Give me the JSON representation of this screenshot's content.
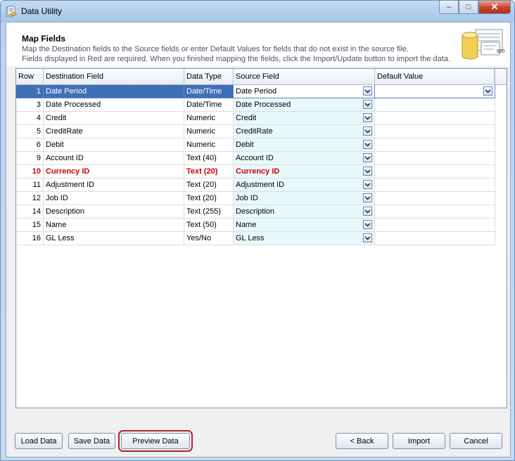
{
  "window": {
    "title": "Data Utility",
    "controls": {
      "minimize": "–",
      "maximize": "□",
      "close": "✕"
    }
  },
  "header": {
    "title": "Map Fields",
    "desc_line1": "Map the Destination fields to the Source fields or enter Default Values for fields that do not exist in the source file.",
    "desc_line2": "Fields displayed in Red are required.  When you finished mapping the fields, click the Import/Update button to import the data.",
    "icon_text": "620"
  },
  "grid": {
    "columns": {
      "row": "Row",
      "destination": "Destination Field",
      "type": "Data Type",
      "source": "Source Field",
      "default": "Default Value"
    },
    "rows": [
      {
        "row": "1",
        "destination": "Date Period",
        "type": "Date/Time",
        "source": "Date Period",
        "default": ""
      },
      {
        "row": "3",
        "destination": "Date Processed",
        "type": "Date/Time",
        "source": "Date Processed",
        "default": ""
      },
      {
        "row": "4",
        "destination": "Credit",
        "type": "Numeric",
        "source": "Credit",
        "default": ""
      },
      {
        "row": "5",
        "destination": "CreditRate",
        "type": "Numeric",
        "source": "CreditRate",
        "default": ""
      },
      {
        "row": "6",
        "destination": "Debit",
        "type": "Numeric",
        "source": "Debit",
        "default": ""
      },
      {
        "row": "9",
        "destination": "Account ID",
        "type": "Text (40)",
        "source": "Account ID",
        "default": ""
      },
      {
        "row": "10",
        "destination": "Currency ID",
        "type": "Text (20)",
        "source": "Currency ID",
        "default": ""
      },
      {
        "row": "11",
        "destination": "Adjustment ID",
        "type": "Text (20)",
        "source": "Adjustment ID",
        "default": ""
      },
      {
        "row": "12",
        "destination": "Job ID",
        "type": "Text (20)",
        "source": "Job ID",
        "default": ""
      },
      {
        "row": "14",
        "destination": "Description",
        "type": "Text (255)",
        "source": "Description",
        "default": ""
      },
      {
        "row": "15",
        "destination": "Name",
        "type": "Text (50)",
        "source": "Name",
        "default": ""
      },
      {
        "row": "16",
        "destination": "GL Less",
        "type": "Yes/No",
        "source": "GL Less",
        "default": ""
      }
    ]
  },
  "buttons": {
    "load": "Load Data",
    "save": "Save Data",
    "preview": "Preview Data",
    "back": "< Back",
    "import": "Import",
    "cancel": "Cancel"
  },
  "colors": {
    "selected_row": "#3f6fb7",
    "required_text": "#d00000",
    "focus_outline": "#b0252e"
  }
}
